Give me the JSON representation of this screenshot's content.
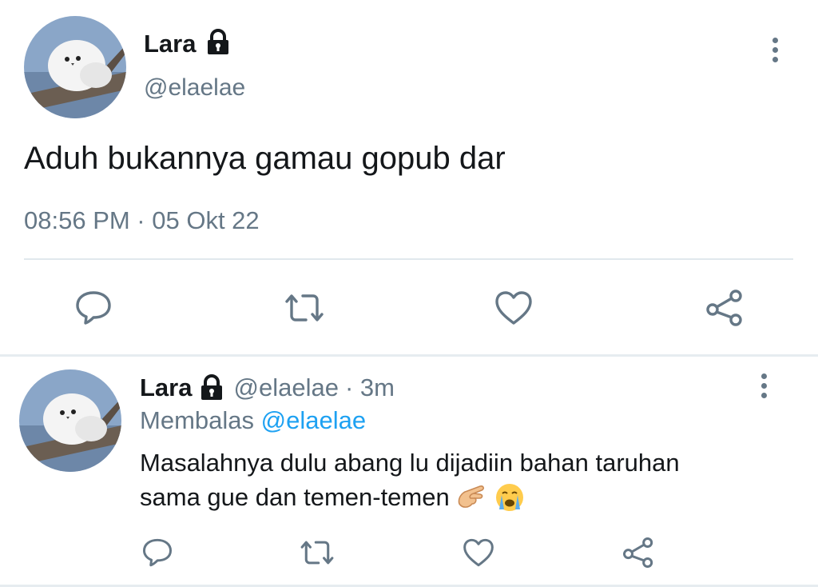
{
  "main_tweet": {
    "name": "Lara",
    "handle": "@elaelae",
    "text": "Aduh bukannya gamau gopub dar",
    "timestamp": "08:56 PM · 05 Okt 22"
  },
  "reply": {
    "name": "Lara",
    "handle": "@elaelae",
    "time": "· 3m",
    "replying_label": "Membalas",
    "replying_to": "@elaelae",
    "text_line1": "Masalahnya dulu abang lu dijadiin bahan taruhan",
    "text_line2": "sama gue dan temen-temen"
  },
  "colors": {
    "accent": "#1da1f2",
    "muted": "#657786",
    "divider": "#e1e8ed"
  },
  "icons": [
    "lock-icon",
    "more-icon",
    "reply-icon",
    "retweet-icon",
    "like-icon",
    "share-icon",
    "pinching-hand-emoji",
    "crying-face-emoji"
  ]
}
